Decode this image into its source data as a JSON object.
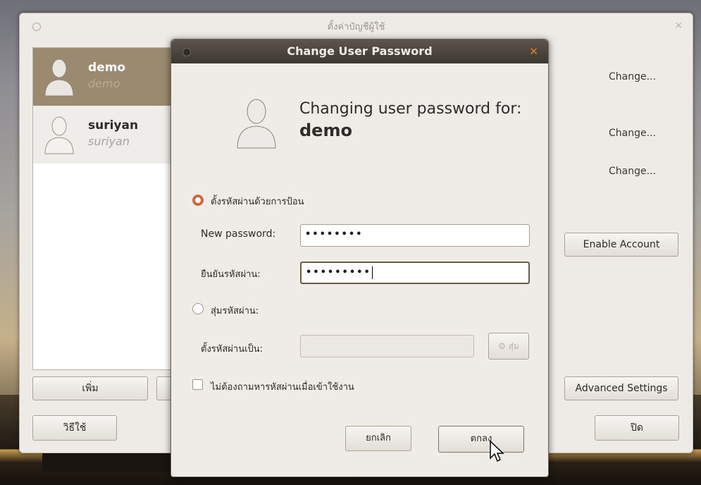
{
  "main_window": {
    "title": "ตั้งค่าบัญชีผู้ใช้",
    "users": [
      {
        "name": "demo",
        "login": "demo"
      },
      {
        "name": "suriyan",
        "login": "suriyan"
      }
    ],
    "change_labels": [
      "Change...",
      "Change...",
      "Change..."
    ],
    "enable_account": "Enable Account",
    "advanced_settings": "Advanced Settings",
    "add_button": "เพิ่ม",
    "manage_button": "วิธีใช้",
    "close_button": "ปิด"
  },
  "dialog": {
    "title": "Change User Password",
    "heading_line1": "Changing user password for:",
    "heading_user": "demo",
    "option_manual": "ตั้งรหัสผ่านด้วยการป้อน",
    "new_password_label": "New password:",
    "new_password_value": "••••••••",
    "confirm_label": "ยืนยันรหัสผ่าน:",
    "confirm_value": "•••••••••",
    "option_random": "สุ่มรหัสผ่าน:",
    "set_as_label": "ตั้งรหัสผ่านเป็น:",
    "random_button": "สุ่ม",
    "no_ask_checkbox": "ไม่ต้องถามหารหัสผ่านเมื่อเข้าใช้งาน",
    "cancel_button": "ยกเลิก",
    "ok_button": "ตกลง"
  }
}
